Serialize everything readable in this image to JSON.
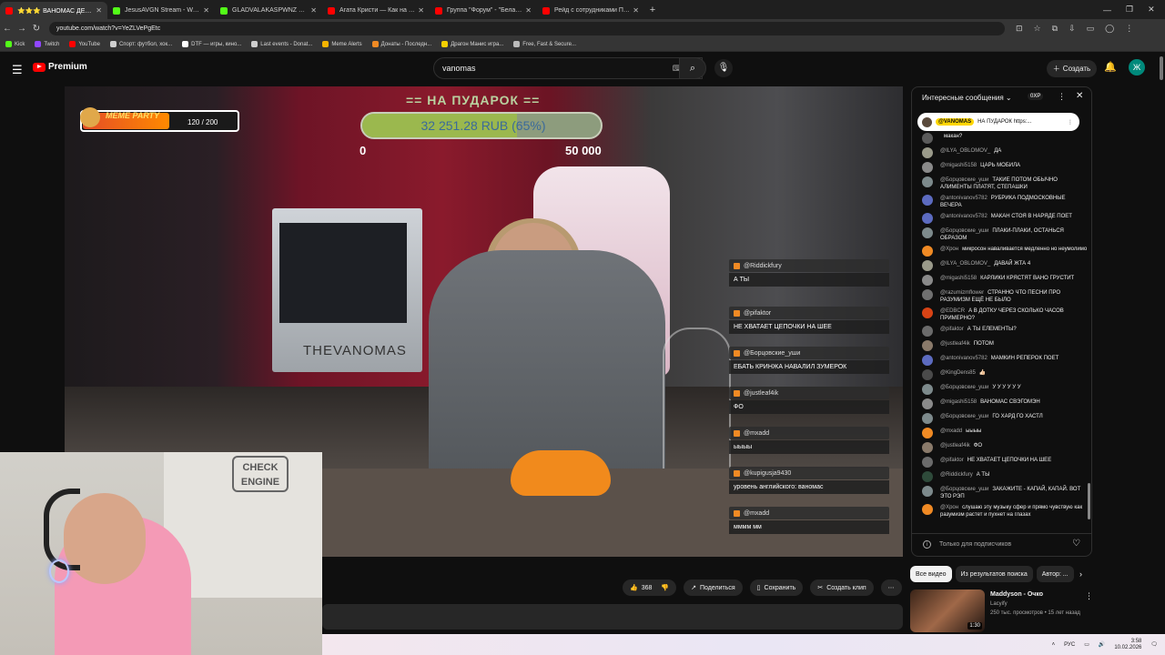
{
  "browser": {
    "tabs": [
      {
        "label": "⭐⭐⭐ ВАНОМАС ДЕНЬ Р...",
        "favicon_color": "#ff0000",
        "active": true
      },
      {
        "label": "JesusAVGN Stream - Watch Li...",
        "favicon_color": "#53fc18",
        "active": false
      },
      {
        "label": "GLADVALAKASPWNZ Stream -...",
        "favicon_color": "#53fc18",
        "active": false
      },
      {
        "label": "Агата Кристи — Как на войне",
        "favicon_color": "#ff0000",
        "active": false
      },
      {
        "label": "Группа \"Форум\" - \"Белая ночь\"",
        "favicon_color": "#ff0000",
        "active": false
      },
      {
        "label": "Рейд с сотрудниками ППСП...",
        "favicon_color": "#ff0000",
        "active": false
      }
    ],
    "new_tab": "+",
    "url": "youtube.com/watch?v=YeZLVePgEtc",
    "bookmarks": [
      {
        "label": "Kick",
        "color": "#53fc18"
      },
      {
        "label": "Twitch",
        "color": "#9146ff"
      },
      {
        "label": "YouTube",
        "color": "#ff0000"
      },
      {
        "label": "Спорт: футбол, хок...",
        "color": "#cfcfcf"
      },
      {
        "label": "DTF — игры, кино...",
        "color": "#ffffff"
      },
      {
        "label": "Last events - Donat...",
        "color": "#cfcfcf"
      },
      {
        "label": "Meme Alerts",
        "color": "#f5b400"
      },
      {
        "label": "Донаты - Последн...",
        "color": "#f08a24"
      },
      {
        "label": "Драгон Манис игра...",
        "color": "#f5d000"
      },
      {
        "label": "Free, Fast & Secure...",
        "color": "#bbbbbb"
      }
    ]
  },
  "youtube": {
    "logo_text": "Premium",
    "search_value": "vanomas",
    "create_label": "Создать",
    "avatar_letter": "Ж"
  },
  "video_overlay": {
    "meme_title": "MEME PARTY",
    "meme_count": "120 / 200",
    "meme_progress": 0.6,
    "donation_title": "== НА ПУДАРОК ==",
    "donation_value": "32 251.28 RUB (65%)",
    "donation_progress": 0.65,
    "donation_min": "0",
    "donation_max": "50 000",
    "chat": [
      {
        "user": "@Riddickfury",
        "text": "А ТЫ"
      },
      {
        "user": "@pifaktor",
        "text": "НЕ ХВАТАЕТ ЦЕПОЧКИ НА ШЕЕ"
      },
      {
        "user": "@Борцовские_уши",
        "text": "ЕБАТЬ КРИНЖА НАВАЛИЛ ЗУМЕРОК"
      },
      {
        "user": "@justleaf4ik",
        "text": "ФО"
      },
      {
        "user": "@mxadd",
        "text": "ыыыы"
      },
      {
        "user": "@kupigusja9430",
        "text": "уровень английского: ваномас"
      },
      {
        "user": "@mxadd",
        "text": "мммм мм"
      }
    ],
    "pc_label": "THEVANOMAS",
    "cam_sign": "CHECK ENGINE"
  },
  "actions": {
    "likes": "368",
    "share": "Поделиться",
    "save": "Сохранить",
    "clip": "Создать клип"
  },
  "chat_panel": {
    "title": "Интересные сообщения",
    "xp": "0XP",
    "pinned_user": "@VANOMAS",
    "pinned_text": "НА ПУДАРОК https:...",
    "messages": [
      {
        "user": "",
        "text": "макан?",
        "color": "#5b5b5b"
      },
      {
        "user": "@ILYA_OBLOMOV_",
        "text": "ДА",
        "color": "#9a9a8a"
      },
      {
        "user": "@migashi5158",
        "text": "ЦАРЬ МОБИЛА",
        "color": "#8a8a8a"
      },
      {
        "user": "@Борцовские_уши",
        "text": "ТАКИЕ ПОТОМ ОБЫЧНО АЛИМЕНТЫ ПЛАТЯТ, СТЕПАШКИ",
        "color": "#7d8a8c"
      },
      {
        "user": "@antonivanov5782",
        "text": "РУБРИКА ПОДМОСКОВНЫЕ ВЕЧЕРА",
        "color": "#5c6bc0"
      },
      {
        "user": "@antonivanov5782",
        "text": "МАКАН СТОЯ В НАРЯДЕ ПОЕТ",
        "color": "#5c6bc0"
      },
      {
        "user": "@Борцовские_уши",
        "text": "ПЛАКИ-ПЛАКИ, ОСТАНЬСЯ ОБРАЗОМ",
        "color": "#7d8a8c"
      },
      {
        "user": "@Хрон",
        "text": "микросон наваливается медленно но неумолимо",
        "color": "#f08a24"
      },
      {
        "user": "@ILYA_OBLOMOV_",
        "text": "ДАВАЙ ЖТА 4",
        "color": "#9a9a8a"
      },
      {
        "user": "@migashi5158",
        "text": "КАРЛИКИ КРЯСТЯТ ВАНО ГРУСТИТ",
        "color": "#8a8a8a"
      },
      {
        "user": "@razumizmflower",
        "text": "СТРАННО ЧТО ПЕСНИ ПРО РАЗУМИЗМ ЕЩЁ НЕ БЫЛО",
        "color": "#707070"
      },
      {
        "user": "@EDBCR",
        "text": "А В ДОТКУ ЧЕРЕЗ СКОЛЬКО ЧАСОВ ПРИМЕРНО?",
        "color": "#d84315"
      },
      {
        "user": "@pifaktor",
        "text": "А ТЫ ЕЛЕМЕНТЫ?",
        "color": "#6b6b6b"
      },
      {
        "user": "@justleaf4ik",
        "text": "ПОТОМ",
        "color": "#8a7a6a"
      },
      {
        "user": "@antonivanov5782",
        "text": "МАМКИН РЕПЕРОК ПОЕТ",
        "color": "#5c6bc0"
      },
      {
        "user": "@KingDens85",
        "text": "👍🏻",
        "color": "#4a4a4a"
      },
      {
        "user": "@Борцовские_уши",
        "text": "У У У У У У",
        "color": "#7d8a8c"
      },
      {
        "user": "@migashi5158",
        "text": "ВАНОМАС СВЭГОМЭН",
        "color": "#8a8a8a"
      },
      {
        "user": "@Борцовские_уши",
        "text": "ГО ХАРД ГО ХАСТЛ",
        "color": "#7d8a8c"
      },
      {
        "user": "@mxadd",
        "text": "ыыыы",
        "color": "#f08a24"
      },
      {
        "user": "@justleaf4ik",
        "text": "ФО",
        "color": "#8a7a6a"
      },
      {
        "user": "@pifaktor",
        "text": "НЕ ХВАТАЕТ ЦЕПОЧКИ НА ШЕЕ",
        "color": "#6b6b6b"
      },
      {
        "user": "@Riddickfury",
        "text": "А ТЫ",
        "color": "#2e4a3a"
      },
      {
        "user": "@Борцовские_уши",
        "text": "ЗАКАЖИТЕ - КАПАЙ, КАПАЙ. ВОТ ЭТО РЭП",
        "color": "#7d8a8c"
      },
      {
        "user": "@Хрон",
        "text": "слушаю эту музыку сфер и прямо чувствую как разумизм растет и пухнет на глазах",
        "color": "#f08a24"
      }
    ],
    "footer": "Только для подписчиков"
  },
  "recommendations": {
    "chips": [
      "Все видео",
      "Из результатов поиска",
      "Автор: ..."
    ],
    "items": [
      {
        "title": "Maddyson - Очко",
        "channel": "Lacyify",
        "meta": "250 тыс. просмотров • 15 лет назад",
        "duration": "1:30"
      }
    ]
  },
  "taskbar": {
    "lang": "РУС",
    "time": "3:58",
    "date": "10.02.2026"
  }
}
